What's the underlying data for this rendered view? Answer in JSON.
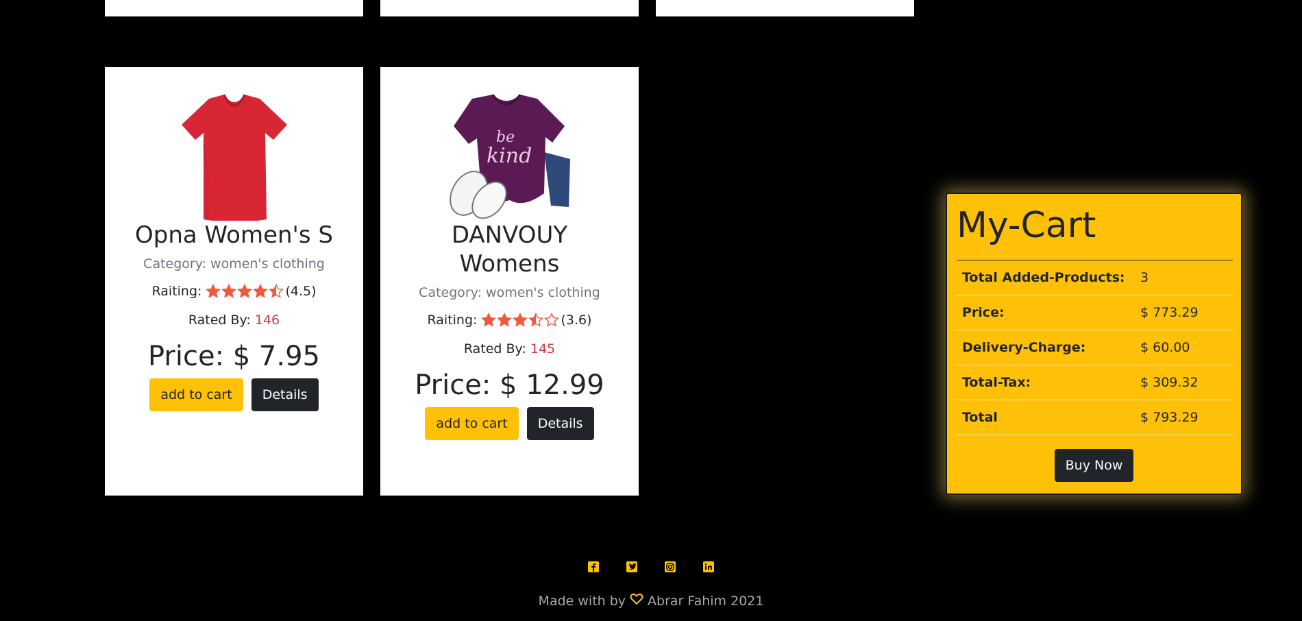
{
  "products": [
    {
      "title": "Opna Women's S",
      "category_label": "Category:",
      "category": "women's clothing",
      "rating_label": "Raiting:",
      "rating": 4.5,
      "rating_text": "(4.5)",
      "rated_by_label": "Rated By:",
      "rated_by": "146",
      "price_label": "Price:",
      "price": "$ 7.95",
      "add_label": "add to cart",
      "details_label": "Details",
      "image_icon": "red-tshirt"
    },
    {
      "title": "DANVOUY Womens",
      "category_label": "Category:",
      "category": "women's clothing",
      "rating_label": "Raiting:",
      "rating": 3.6,
      "rating_text": "(3.6)",
      "rated_by_label": "Rated By:",
      "rated_by": "145",
      "price_label": "Price:",
      "price": "$ 12.99",
      "add_label": "add to cart",
      "details_label": "Details",
      "image_icon": "purple-tshirt"
    }
  ],
  "cart": {
    "title": "My-Cart",
    "rows": [
      {
        "label": "Total Added-Products:",
        "value": "3"
      },
      {
        "label": "Price:",
        "value": "$ 773.29"
      },
      {
        "label": "Delivery-Charge:",
        "value": "$ 60.00"
      },
      {
        "label": "Total-Tax:",
        "value": "$ 309.32"
      },
      {
        "label": "Total",
        "value": "$ 793.29"
      }
    ],
    "buy_label": "Buy Now"
  },
  "footer": {
    "icons": [
      "facebook-icon",
      "twitter-icon",
      "instagram-icon",
      "linkedin-icon"
    ],
    "made_with": "Made with by",
    "author": "Abrar Fahim 2021"
  },
  "colors": {
    "accent": "#ffc107",
    "dark": "#212529",
    "star": "#f05a3c",
    "count": "#dc3545"
  }
}
